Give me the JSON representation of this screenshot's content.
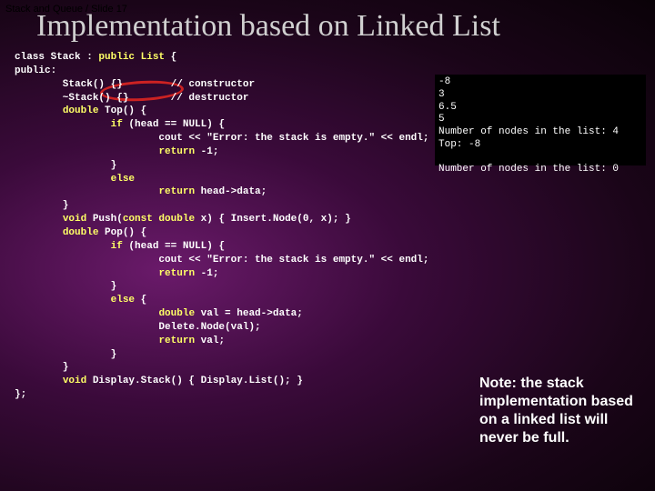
{
  "breadcrumb": "Stack and Queue / Slide 17",
  "title": "Implementation based on Linked List",
  "code": {
    "l01a": "class Stack : ",
    "l01b": "public List",
    "l01c": " {",
    "l02": "public:",
    "l03": "        Stack() {}        // constructor",
    "l04": "        ~Stack() {}       // destructor",
    "l05a": "        ",
    "l05b": "double",
    "l05c": " Top() {",
    "l06a": "                ",
    "l06b": "if",
    "l06c": " (head == NULL) {",
    "l07": "                        cout << \"Error: the stack is empty.\" << endl;",
    "l08a": "                        ",
    "l08b": "return",
    "l08c": " -1;",
    "l09": "                }",
    "l10a": "                ",
    "l10b": "else",
    "l11a": "                        ",
    "l11b": "return",
    "l11c": " head->data;",
    "l12": "        }",
    "l13a": "        ",
    "l13b": "void",
    "l13c": " Push(",
    "l13d": "const double",
    "l13e": " x) { Insert.Node(0, x); }",
    "l14a": "        ",
    "l14b": "double",
    "l14c": " Pop() {",
    "l15a": "                ",
    "l15b": "if",
    "l15c": " (head == NULL) {",
    "l16": "                        cout << \"Error: the stack is empty.\" << endl;",
    "l17a": "                        ",
    "l17b": "return",
    "l17c": " -1;",
    "l18": "                }",
    "l19a": "                ",
    "l19b": "else",
    "l19c": " {",
    "l20a": "                        ",
    "l20b": "double",
    "l20c": " val = head->data;",
    "l21": "                        Delete.Node(val);",
    "l22a": "                        ",
    "l22b": "return",
    "l22c": " val;",
    "l23": "                }",
    "l24": "        }",
    "l25a": "        ",
    "l25b": "void",
    "l25c": " Display.Stack() { Display.List(); }",
    "l26": "};"
  },
  "output": "-8\n3\n6.5\n5\nNumber of nodes in the list: 4\nTop: -8\n\nNumber of nodes in the list: 0",
  "note": "Note: the stack implementation based on a linked list will never be full."
}
